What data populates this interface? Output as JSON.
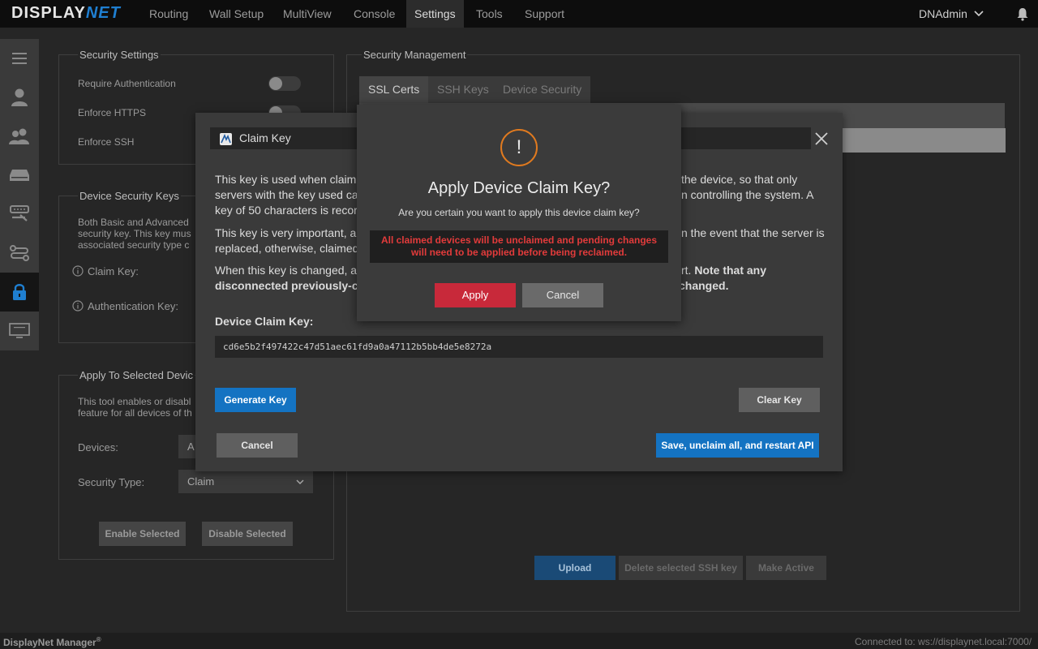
{
  "nav": {
    "logo_a": "DISPLAY",
    "logo_b": "NET",
    "items": [
      "Routing",
      "Wall Setup",
      "MultiView",
      "Console",
      "Settings",
      "Tools",
      "Support"
    ],
    "user": "DNAdmin"
  },
  "security_settings": {
    "title": "Security Settings",
    "require_auth": "Require Authentication",
    "enforce_https": "Enforce HTTPS",
    "enforce_ssh": "Enforce SSH"
  },
  "device_keys": {
    "title": "Device Security Keys",
    "desc1": "Both Basic and Advanced",
    "desc2": "security key. This key mus",
    "desc3": "associated security type c",
    "claim_key": "Claim Key:",
    "auth_key": "Authentication Key:"
  },
  "apply_selected": {
    "title": "Apply To Selected Devic",
    "desc1": "This tool enables or disabl",
    "desc2": "feature for all devices of th",
    "devices_label": "Devices:",
    "devices_value": "A",
    "security_type_label": "Security Type:",
    "security_type_value": "Claim",
    "enable_btn": "Enable Selected",
    "disable_btn": "Disable Selected"
  },
  "security_management": {
    "title": "Security Management",
    "tabs": [
      "SSL Certs",
      "SSH Keys",
      "Device Security"
    ],
    "upload_btn": "Upload",
    "delete_btn": "Delete selected SSH key",
    "make_active_btn": "Make Active"
  },
  "claim_modal": {
    "title": "Claim Key",
    "p1_l1a": "This key is used when claimi",
    "p1_l1b": "the device, so that only",
    "p1_l2a": "servers with the key used ca",
    "p1_l2b": "n controlling the system. A",
    "p1_l3": "key of 50 characters is recor",
    "p2_l1a": "This key is very important, ar",
    "p2_l1b": "n the event that the server is",
    "p2_l2": "replaced, otherwise, claimed",
    "p3_l1a": "When this key is changed, al",
    "p3_l1b": "rt.",
    "p3_l1c": "Note that any",
    "p3_l2a": "disconnected previously-cla",
    "p3_l2b": "changed.",
    "key_label": "Device Claim Key:",
    "key_value": "cd6e5b2f497422c47d51aec61fd9a0a47112b5bb4de5e8272a",
    "generate_btn": "Generate Key",
    "clear_btn": "Clear Key",
    "cancel_btn": "Cancel",
    "save_btn": "Save, unclaim all, and restart API"
  },
  "confirm": {
    "title": "Apply Device Claim Key?",
    "question": "Are you certain you want to apply this device claim key?",
    "warning_l1": "All claimed devices will be unclaimed and pending changes",
    "warning_l2": "will need to be applied before being reclaimed.",
    "apply_btn": "Apply",
    "cancel_btn": "Cancel"
  },
  "footer": {
    "app_name": "DisplayNet Manager",
    "reg": "®",
    "connection": "Connected to: ws://displaynet.local:7000/"
  },
  "colors": {
    "accent": "#1473c2",
    "danger": "#c8293a",
    "warning_icon": "#e07a1f"
  }
}
